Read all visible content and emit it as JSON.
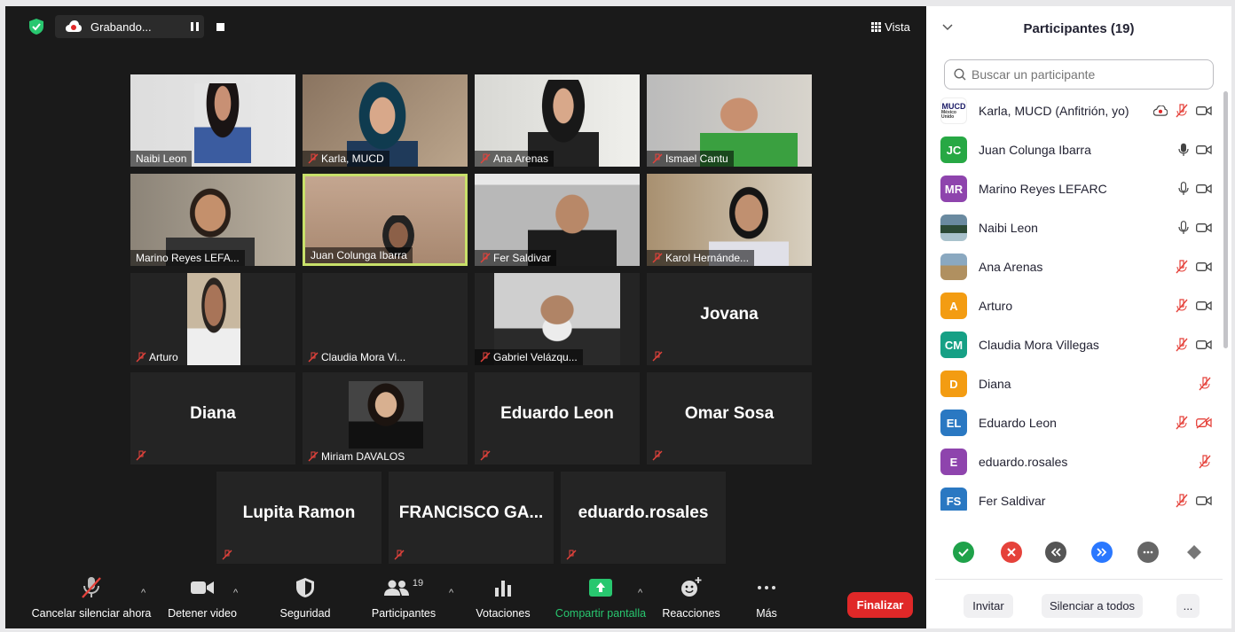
{
  "topbar": {
    "recording_label": "Grabando...",
    "view_label": "Vista"
  },
  "tiles": {
    "t1": "Naibi Leon",
    "t2": "Karla, MUCD",
    "t3": "Ana Arenas",
    "t4": "Ismael Cantu",
    "t5": "Marino Reyes LEFA...",
    "t6": "Juan Colunga Ibarra",
    "t7": "Fer Saldivar",
    "t8": "Karol Hernánde...",
    "t9": "Arturo",
    "t10": "Claudia Mora Vi...",
    "t11": "Gabriel Velázqu...",
    "t12": "Jovana",
    "t13": "Diana",
    "t14": "Miriam DAVALOS",
    "t15": "Eduardo Leon",
    "t16": "Omar Sosa",
    "t17": "Lupita Ramon",
    "t18": "FRANCISCO  GA...",
    "t19": "eduardo.rosales"
  },
  "controls": {
    "mute": "Cancelar silenciar ahora",
    "video": "Detener video",
    "security": "Seguridad",
    "participants": "Participantes",
    "participants_count": "19",
    "polls": "Votaciones",
    "share": "Compartir pantalla",
    "reactions": "Reacciones",
    "more": "Más",
    "end": "Finalizar"
  },
  "panel": {
    "title": "Participantes (19)",
    "search_placeholder": "Buscar un participante",
    "participants": [
      {
        "name": "Karla, MUCD (Anfitrión, yo)",
        "logo": "MUCD"
      },
      {
        "name": "Juan Colunga Ibarra",
        "initials": "JC",
        "color": "#27a844"
      },
      {
        "name": "Marino Reyes LEFARC",
        "initials": "MR",
        "color": "#8e44ad"
      },
      {
        "name": "Naibi Leon"
      },
      {
        "name": "Ana Arenas"
      },
      {
        "name": "Arturo",
        "initials": "A",
        "color": "#f39c12"
      },
      {
        "name": "Claudia Mora Villegas",
        "initials": "CM",
        "color": "#16a085"
      },
      {
        "name": "Diana",
        "initials": "D",
        "color": "#f39c12"
      },
      {
        "name": "Eduardo Leon",
        "initials": "EL",
        "color": "#2a78c2"
      },
      {
        "name": "eduardo.rosales",
        "initials": "E",
        "color": "#8e44ad"
      },
      {
        "name": "Fer Saldivar",
        "initials": "FS",
        "color": "#2a78c2"
      }
    ],
    "invite": "Invitar",
    "mute_all": "Silenciar a todos",
    "more": "..."
  },
  "colors": {
    "accent_green": "#28c76f",
    "end_red": "#e02828",
    "host_highlight": "#c8e06a",
    "muted_red": "#e5423b"
  }
}
